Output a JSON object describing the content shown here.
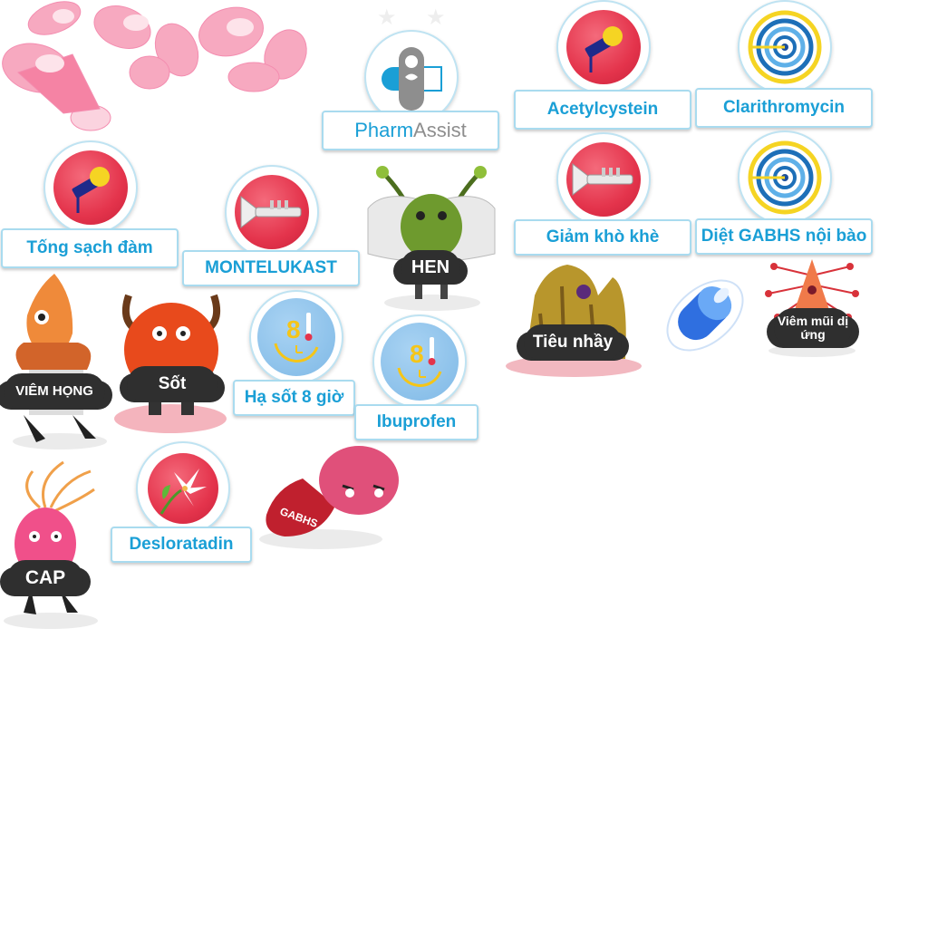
{
  "logo": {
    "text_part1": "Pharm",
    "text_part2": "Assist"
  },
  "drug_cards": [
    {
      "id": "acetylcystein",
      "label": "Acetylcystein",
      "icon": "microphone-icon"
    },
    {
      "id": "clarithromycin",
      "label": "Clarithromycin",
      "icon": "target-rings-icon"
    },
    {
      "id": "tong-sach-dam",
      "label": "Tống sạch đàm",
      "icon": "microphone-icon"
    },
    {
      "id": "montelukast",
      "label": "MONTELUKAST",
      "icon": "trumpet-icon"
    },
    {
      "id": "giam-kho-khe",
      "label": "Giảm khò khè",
      "icon": "trumpet-icon"
    },
    {
      "id": "diet-gabhs",
      "label": "Diệt GABHS nội bào",
      "icon": "target-rings-icon"
    },
    {
      "id": "ha-sot",
      "label": "Hạ sốt 8 giờ",
      "icon": "clock-8-icon"
    },
    {
      "id": "ibuprofen",
      "label": "Ibuprofen",
      "icon": "clock-8-icon"
    },
    {
      "id": "desloratadin",
      "label": "Desloratadin",
      "icon": "lily-flower-icon"
    }
  ],
  "monsters": [
    {
      "id": "hen",
      "label": "HEN"
    },
    {
      "id": "viem-hong",
      "label": "VIÊM HỌNG"
    },
    {
      "id": "sot",
      "label": "Sốt"
    },
    {
      "id": "tieu-nhay",
      "label": "Tiêu nhầy"
    },
    {
      "id": "viem-mui",
      "label": "Viêm mũi dị ứng"
    },
    {
      "id": "cap",
      "label": "CAP"
    },
    {
      "id": "gabhs",
      "label": "GABHS"
    }
  ],
  "colors": {
    "label_text": "#1a9fd6",
    "badge_red": "#e4344c",
    "badge_blue": "#7fb9e6",
    "cloud": "#2f2f2f"
  }
}
